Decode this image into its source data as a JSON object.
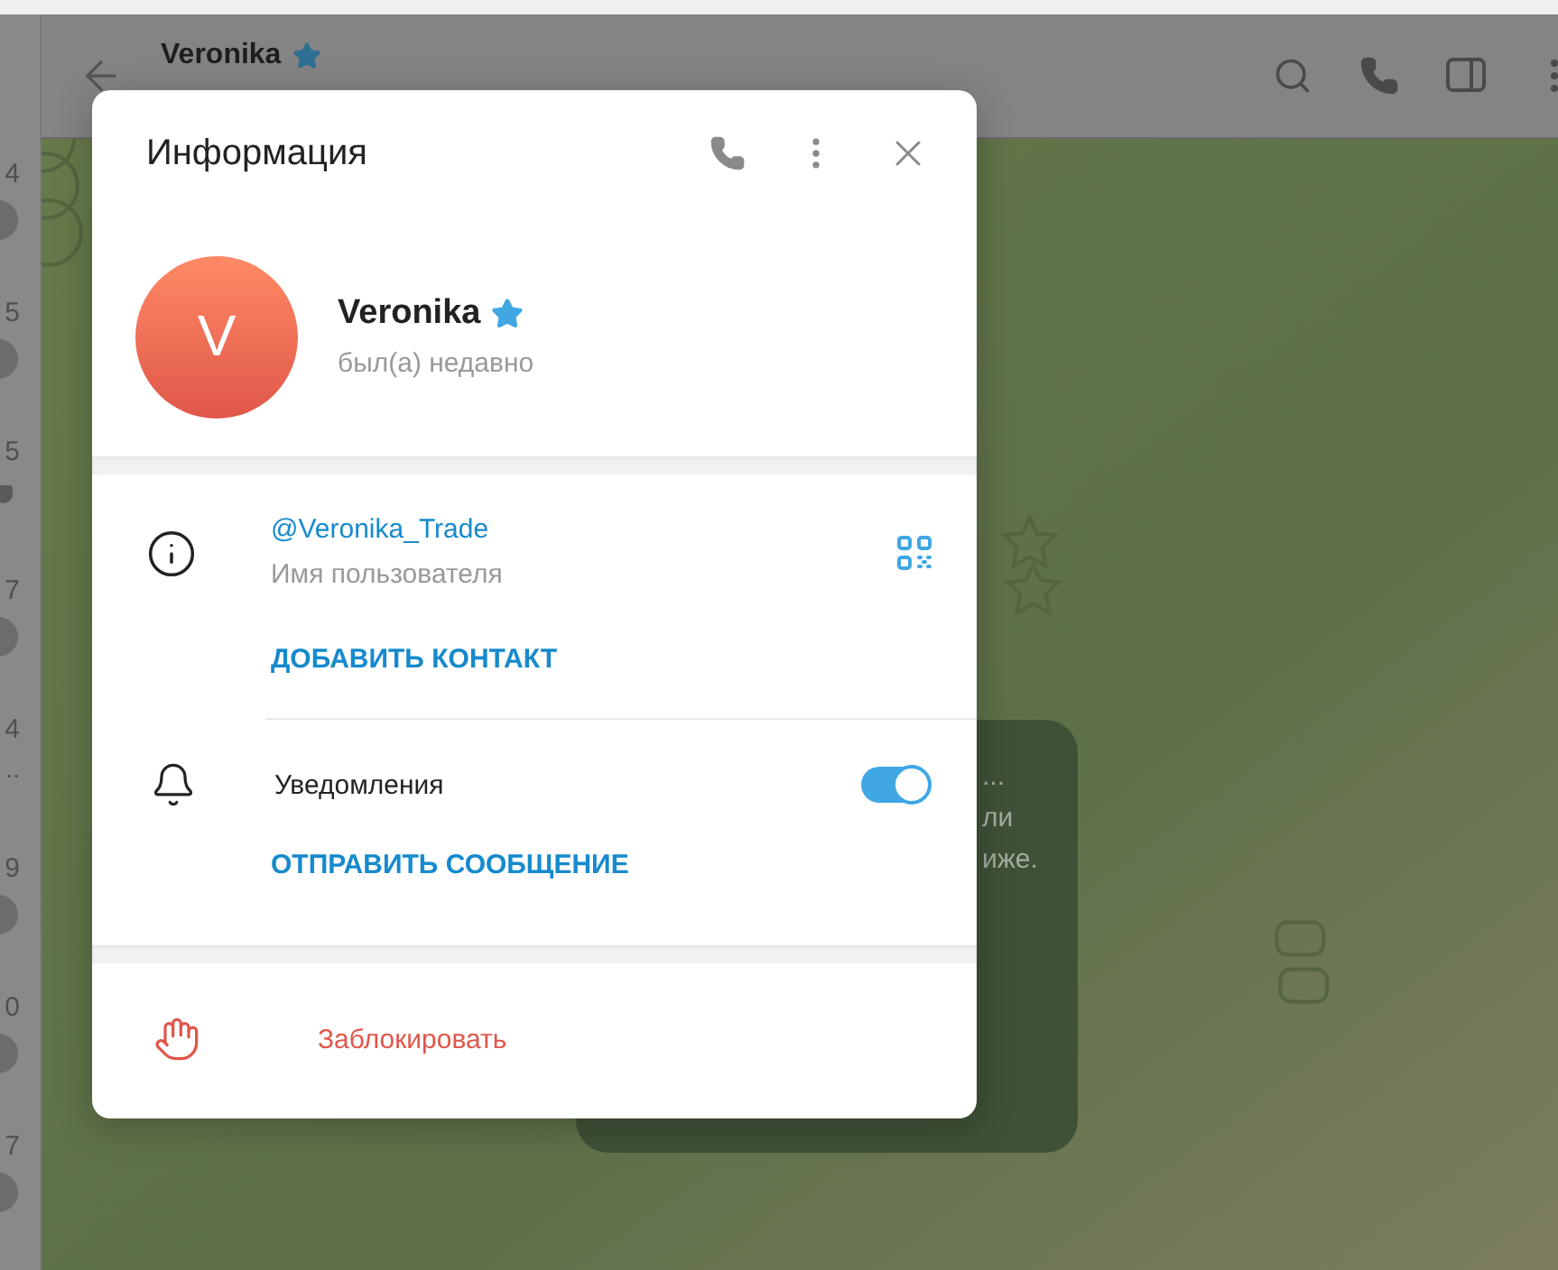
{
  "chat_list": {
    "items": [
      {
        "time": "4",
        "kind": "badge"
      },
      {
        "time": "5",
        "kind": "badge"
      },
      {
        "time": "5",
        "kind": "pin"
      },
      {
        "time": "7",
        "kind": "badge"
      },
      {
        "time": "4",
        "kind": "text",
        "text": ".."
      },
      {
        "time": "9",
        "kind": "badge"
      },
      {
        "time": "0",
        "kind": "badge"
      },
      {
        "time": "7",
        "kind": "badge"
      }
    ]
  },
  "chat_header": {
    "title": "Veronika",
    "premium": true
  },
  "message": {
    "lines": [
      "...",
      "ли",
      "иже."
    ]
  },
  "dialog": {
    "title": "Информация",
    "profile": {
      "avatar_letter": "V",
      "name": "Veronika",
      "premium": true,
      "status": "был(а) недавно"
    },
    "username": "@Veronika_Trade",
    "username_label": "Имя пользователя",
    "add_contact": "ДОБАВИТЬ КОНТАКТ",
    "notifications": {
      "label": "Уведомления",
      "on": true
    },
    "send_message": "ОТПРАВИТЬ СООБЩЕНИЕ",
    "block": "Заблокировать"
  }
}
